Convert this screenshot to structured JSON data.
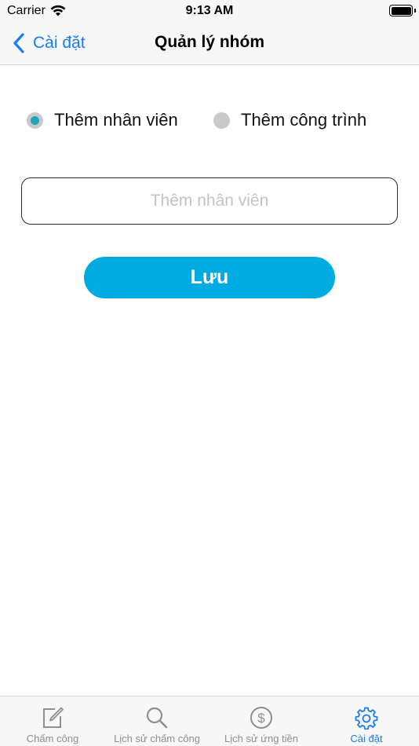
{
  "status_bar": {
    "carrier": "Carrier",
    "time": "9:13 AM"
  },
  "nav": {
    "back_label": "Cài đặt",
    "title": "Quản lý nhóm"
  },
  "options": [
    {
      "label": "Thêm nhân viên",
      "selected": true
    },
    {
      "label": "Thêm công trình",
      "selected": false
    }
  ],
  "input": {
    "placeholder": "Thêm nhân viên",
    "value": ""
  },
  "save_label": "Lưu",
  "colors": {
    "accent": "#00abe1",
    "link": "#1a7cf5",
    "radio_selected": "#1ea3c1",
    "tab_inactive": "#8e8e93"
  },
  "tabs": [
    {
      "label": "Chấm công",
      "icon": "compose-icon",
      "active": false
    },
    {
      "label": "Lịch sử chấm công",
      "icon": "search-icon",
      "active": false
    },
    {
      "label": "Lịch sử ứng tiền",
      "icon": "dollar-icon",
      "active": false
    },
    {
      "label": "Cài đặt",
      "icon": "gear-icon",
      "active": true
    }
  ]
}
